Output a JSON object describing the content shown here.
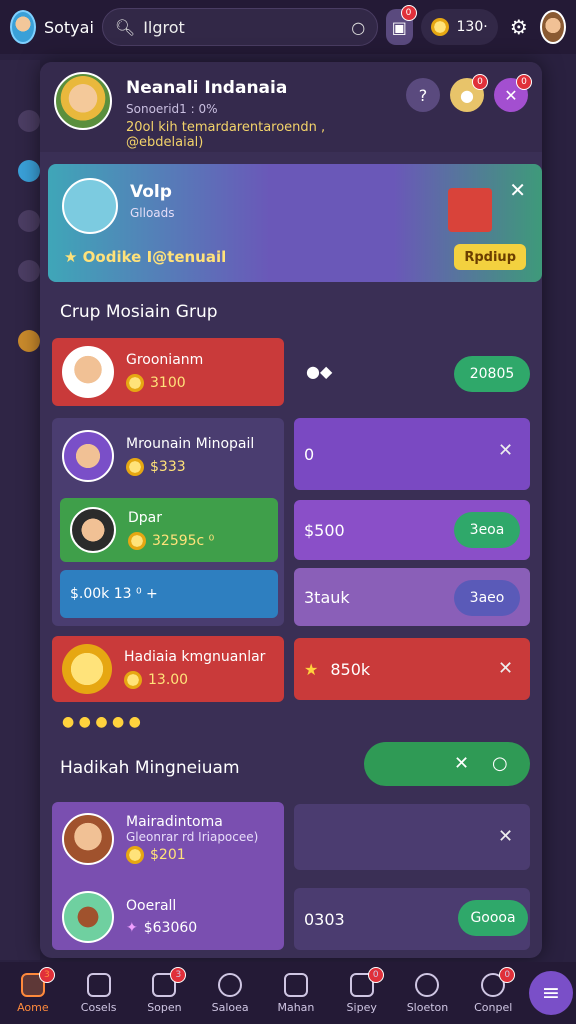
{
  "topbar": {
    "username": "Sotyai",
    "search_value": "Ilgrot",
    "coin_count": "130·",
    "notification_badge": "0"
  },
  "panel": {
    "title": "Neanali Indanaia",
    "subtitle": "Sonoerid1 : 0%",
    "line": "20ol kih temardarentaroendn , @ebdelaial)",
    "badge_help": "0",
    "badge_close": "0"
  },
  "banner": {
    "title": "Volp",
    "sub": "Glloads",
    "footer": "Oodike I@tenuail",
    "cta": "Rpdiup"
  },
  "section1": "Crup Mosiain Grup",
  "cards": {
    "c1": {
      "title": "Groonianm",
      "value": "3100"
    },
    "c1_button": "20805",
    "c2": {
      "title": "Mrounain Minopail",
      "value": "$333"
    },
    "c2_right": "0",
    "c3": {
      "title": "Dpar",
      "value": "32595c ⁰"
    },
    "c3_right": "$500",
    "c3_button": "3eoa",
    "c4": {
      "value": "$.00k 13 ⁰ +"
    },
    "c4_right": "3tauk",
    "c4_button": "3aeo",
    "c5": {
      "title": "Hadiaia kmgnuanlar",
      "value": "13.00"
    },
    "c5_right": "850k"
  },
  "section2": "Hadikah Mingneiuam",
  "cards2": {
    "c6": {
      "title": "Mairadintoma",
      "sub": "Gleonrar rd Iriapocee)",
      "value": "$201"
    },
    "c7": {
      "title": "Ooerall",
      "value": "$63060"
    },
    "c7_right": "0303",
    "c7_button": "Goooa"
  },
  "nav": [
    {
      "label": "Aome",
      "badge": "3"
    },
    {
      "label": "Cosels",
      "badge": ""
    },
    {
      "label": "Sopen",
      "badge": "3"
    },
    {
      "label": "Saloea",
      "badge": ""
    },
    {
      "label": "Mahan",
      "badge": ""
    },
    {
      "label": "Sipey",
      "badge": "0"
    },
    {
      "label": "Sloeton",
      "badge": ""
    },
    {
      "label": "Conpel",
      "badge": "0"
    }
  ],
  "colors": {
    "accent": "#7a4fc8",
    "active_nav": "#ff8a3c",
    "green_btn": "#2fa86a"
  }
}
